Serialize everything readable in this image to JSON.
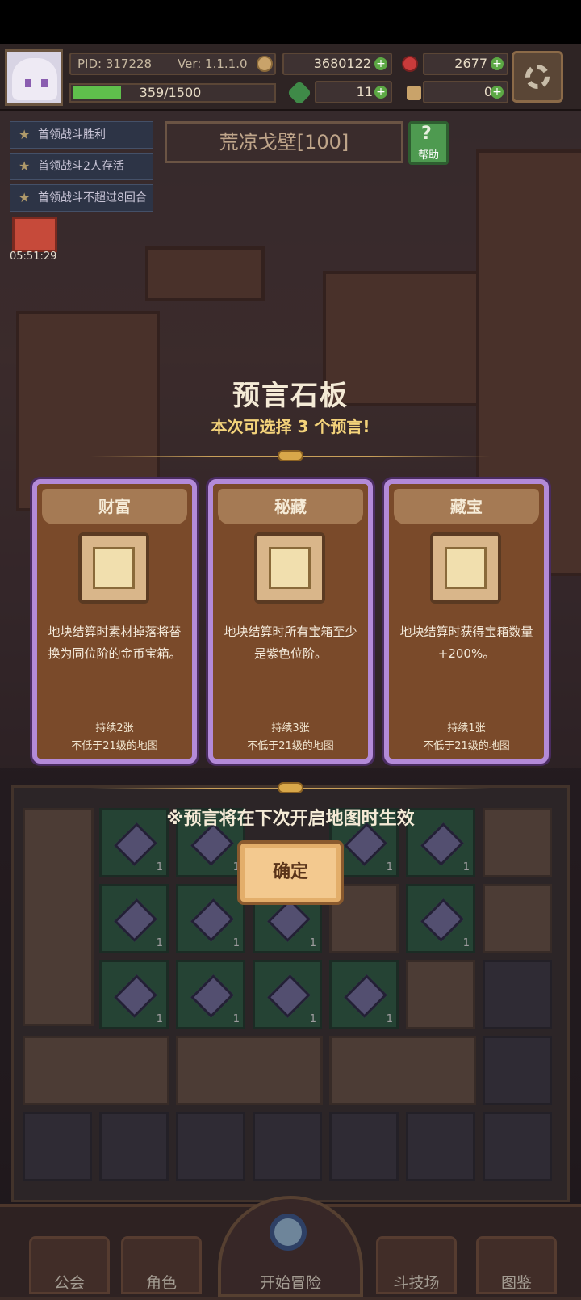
{
  "header": {
    "pid": "PID: 317228",
    "version": "Ver: 1.1.1.0",
    "gold": "3680122",
    "gems": "2677",
    "xp": "359/1500",
    "xp_fraction": 0.24,
    "clover": "11",
    "keys": "0"
  },
  "quests": [
    "首领战斗胜利",
    "首领战斗2人存活",
    "首领战斗不超过8回合"
  ],
  "chest_timer": "05:51:29",
  "map": {
    "name": "荒凉戈壁[100]",
    "help_label": "帮助"
  },
  "modal": {
    "title": "预言石板",
    "subtitle": "本次可选择 3 个预言!",
    "note": "※预言将在下次开启地图时生效",
    "confirm_label": "确定",
    "cards": [
      {
        "name": "财富",
        "desc": "地块结算时素材掉落将替换为同位阶的金币宝箱。",
        "duration": "持续2张",
        "requirement": "不低于21级的地图"
      },
      {
        "name": "秘藏",
        "desc": "地块结算时所有宝箱至少是紫色位阶。",
        "duration": "持续3张",
        "requirement": "不低于21级的地图"
      },
      {
        "name": "藏宝",
        "desc": "地块结算时获得宝箱数量+200%。",
        "duration": "持续1张",
        "requirement": "不低于21级的地图"
      }
    ]
  },
  "board": {
    "tile_count": "1"
  },
  "nav": [
    "公会",
    "角色",
    "开始冒险",
    "斗技场",
    "图鉴"
  ]
}
